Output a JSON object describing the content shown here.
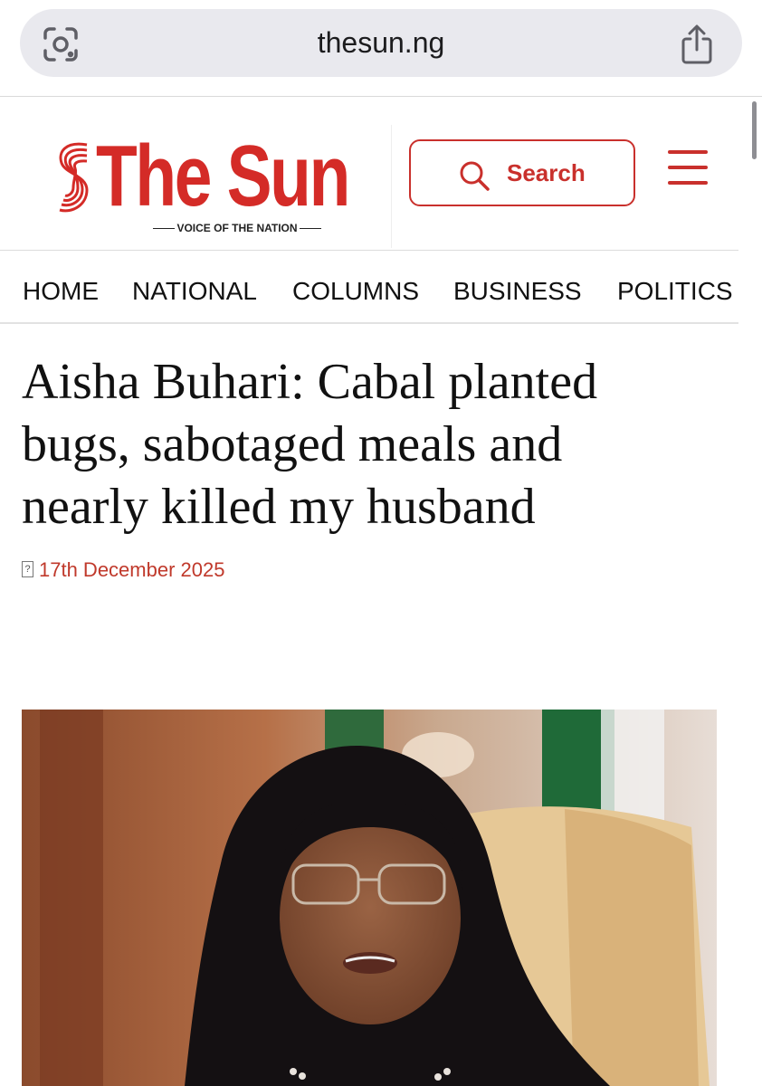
{
  "browser": {
    "url": "thesun.ng",
    "lens_icon": "google-lens-icon",
    "share_icon": "share-icon"
  },
  "site": {
    "name": "The Sun",
    "tagline": "VOICE OF THE NATION",
    "brand_color": "#d42b27",
    "search_label": "Search",
    "menu_icon": "hamburger-menu-icon"
  },
  "nav": {
    "items": [
      "HOME",
      "NATIONAL",
      "COLUMNS",
      "BUSINESS",
      "POLITICS"
    ]
  },
  "article": {
    "headline_lines": [
      "Aisha Buhari: Cabal planted",
      "bugs, sabotaged meals and",
      "nearly killed my husband"
    ],
    "calendar_icon": "?",
    "date": "17th December 2025"
  }
}
